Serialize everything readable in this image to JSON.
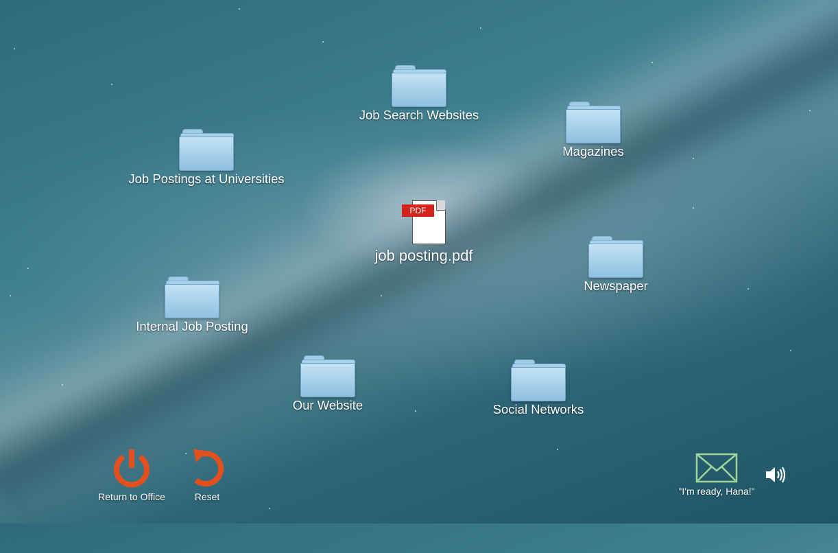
{
  "desktop": {
    "folders": [
      {
        "label": "Job Search Websites"
      },
      {
        "label": "Magazines"
      },
      {
        "label": "Job Postings at Universities"
      },
      {
        "label": "Newspaper"
      },
      {
        "label": "Internal Job Posting"
      },
      {
        "label": "Our Website"
      },
      {
        "label": "Social Networks"
      }
    ],
    "file": {
      "label": "job posting.pdf",
      "badge": "PDF"
    }
  },
  "toolbar": {
    "return_label": "Return to Office",
    "reset_label": "Reset",
    "message_label": "\"I'm ready, Hana!\""
  },
  "colors": {
    "accent_orange": "#e2501e",
    "mail_green": "#9fd49a",
    "folder_blue": "#a6cfe9"
  }
}
